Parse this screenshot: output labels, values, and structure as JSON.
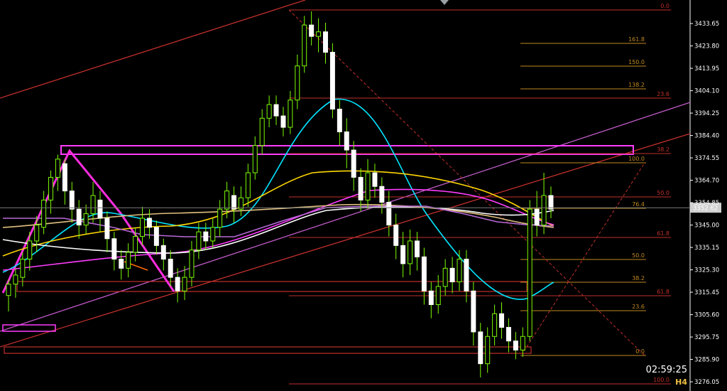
{
  "chart_data": {
    "type": "candlestick",
    "timeframe": "H4",
    "clock": "02:59:25",
    "price_tag": "3352.62",
    "yticks": [
      "3433.65",
      "3423.80",
      "3413.95",
      "3404.10",
      "3394.25",
      "3384.40",
      "3374.55",
      "3364.70",
      "3354.85",
      "3345.00",
      "3335.15",
      "3325.30",
      "3315.45",
      "3305.60",
      "3295.75",
      "3285.90",
      "3276.05"
    ],
    "ylim": [
      3272.0,
      3444.0
    ],
    "colors": {
      "bull": "#7CFC00",
      "bear": "#ffffff",
      "wick": "#7CFC00",
      "grid": "none"
    },
    "candles": [
      [
        3314,
        3319,
        3307,
        3321
      ],
      [
        3319,
        3323,
        3313,
        3326
      ],
      [
        3322,
        3330,
        3318,
        3333
      ],
      [
        3330,
        3338,
        3325,
        3342
      ],
      [
        3338,
        3345,
        3333,
        3349
      ],
      [
        3344,
        3356,
        3341,
        3360
      ],
      [
        3356,
        3366,
        3350,
        3369
      ],
      [
        3366,
        3374,
        3360,
        3376
      ],
      [
        3372,
        3360,
        3354,
        3374
      ],
      [
        3360,
        3352,
        3346,
        3364
      ],
      [
        3352,
        3345,
        3339,
        3356
      ],
      [
        3345,
        3350,
        3341,
        3354
      ],
      [
        3350,
        3358,
        3346,
        3364
      ],
      [
        3356,
        3348,
        3342,
        3360
      ],
      [
        3348,
        3339,
        3333,
        3351
      ],
      [
        3339,
        3330,
        3325,
        3342
      ],
      [
        3330,
        3326,
        3321,
        3334
      ],
      [
        3326,
        3333,
        3322,
        3337
      ],
      [
        3333,
        3340,
        3329,
        3344
      ],
      [
        3340,
        3348,
        3336,
        3353
      ],
      [
        3348,
        3344,
        3339,
        3352
      ],
      [
        3344,
        3336,
        3332,
        3347
      ],
      [
        3336,
        3330,
        3325,
        3339
      ],
      [
        3330,
        3322,
        3318,
        3334
      ],
      [
        3322,
        3316,
        3311,
        3326
      ],
      [
        3316,
        3322,
        3312,
        3327
      ],
      [
        3322,
        3334,
        3318,
        3338
      ],
      [
        3334,
        3342,
        3330,
        3346
      ],
      [
        3342,
        3338,
        3334,
        3346
      ],
      [
        3338,
        3344,
        3335,
        3348
      ],
      [
        3344,
        3352,
        3340,
        3356
      ],
      [
        3352,
        3360,
        3348,
        3364
      ],
      [
        3358,
        3352,
        3346,
        3362
      ],
      [
        3352,
        3357,
        3349,
        3362
      ],
      [
        3357,
        3368,
        3353,
        3372
      ],
      [
        3368,
        3380,
        3365,
        3384
      ],
      [
        3380,
        3392,
        3376,
        3396
      ],
      [
        3392,
        3398,
        3388,
        3402
      ],
      [
        3398,
        3393,
        3389,
        3402
      ],
      [
        3393,
        3388,
        3384,
        3397
      ],
      [
        3388,
        3400,
        3385,
        3404
      ],
      [
        3400,
        3415,
        3396,
        3420
      ],
      [
        3415,
        3433,
        3412,
        3437
      ],
      [
        3433,
        3428,
        3424,
        3439
      ],
      [
        3428,
        3430,
        3421,
        3436
      ],
      [
        3430,
        3421,
        3416,
        3434
      ],
      [
        3421,
        3396,
        3392,
        3425
      ],
      [
        3396,
        3386,
        3380,
        3400
      ],
      [
        3386,
        3378,
        3370,
        3392
      ],
      [
        3378,
        3366,
        3360,
        3382
      ],
      [
        3366,
        3356,
        3351,
        3370
      ],
      [
        3356,
        3368,
        3352,
        3374
      ],
      [
        3368,
        3362,
        3357,
        3372
      ],
      [
        3362,
        3355,
        3350,
        3366
      ],
      [
        3355,
        3345,
        3340,
        3360
      ],
      [
        3345,
        3336,
        3330,
        3350
      ],
      [
        3336,
        3328,
        3322,
        3342
      ],
      [
        3328,
        3338,
        3323,
        3343
      ],
      [
        3338,
        3331,
        3325,
        3342
      ],
      [
        3331,
        3316,
        3310,
        3335
      ],
      [
        3316,
        3310,
        3304,
        3320
      ],
      [
        3310,
        3318,
        3306,
        3323
      ],
      [
        3318,
        3326,
        3314,
        3330
      ],
      [
        3326,
        3320,
        3315,
        3331
      ],
      [
        3320,
        3330,
        3316,
        3334
      ],
      [
        3330,
        3316,
        3311,
        3334
      ],
      [
        3316,
        3298,
        3292,
        3320
      ],
      [
        3298,
        3284,
        3278,
        3302
      ],
      [
        3284,
        3296,
        3280,
        3300
      ],
      [
        3296,
        3306,
        3292,
        3310
      ],
      [
        3306,
        3300,
        3295,
        3311
      ],
      [
        3300,
        3294,
        3289,
        3304
      ],
      [
        3294,
        3290,
        3286,
        3298
      ],
      [
        3290,
        3296,
        3287,
        3300
      ],
      [
        3296,
        3352,
        3294,
        3356
      ],
      [
        3352,
        3345,
        3340,
        3360
      ],
      [
        3345,
        3358,
        3341,
        3368
      ],
      [
        3358,
        3352,
        3348,
        3362
      ]
    ],
    "fib_upper_levels": [
      "0.0",
      "161.8",
      "150.0",
      "138.2",
      "23.6",
      "38.2",
      "100.0",
      "50.0",
      "76.4",
      "61.8",
      "50.0",
      "38.2",
      "23.6",
      "0.0"
    ],
    "fib_lower_levels": [
      "61.8",
      "76.4",
      "100.0"
    ]
  }
}
